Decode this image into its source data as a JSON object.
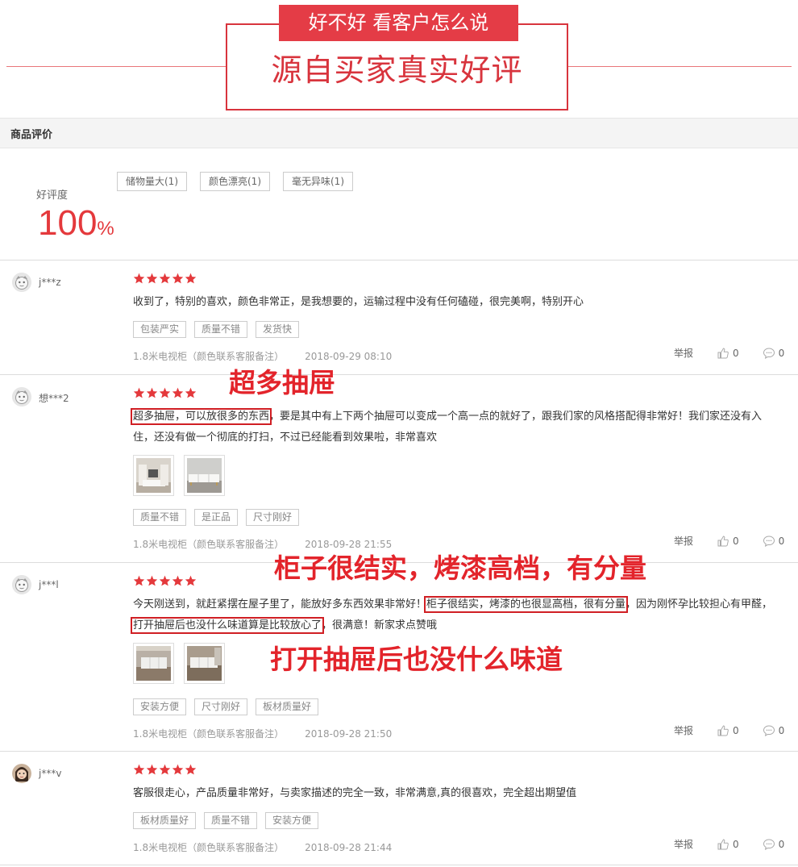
{
  "banner": {
    "tag": "好不好 看客户怎么说",
    "title": "源自买家真实好评"
  },
  "section": {
    "title": "商品评价"
  },
  "summary": {
    "rate_label": "好评度",
    "rate_value": "100",
    "rate_unit": "%",
    "tags": [
      "储物量大(1)",
      "颜色漂亮(1)",
      "毫无异味(1)"
    ]
  },
  "colors": {
    "accent": "#e4393c",
    "annotation": "#e3242b",
    "banner_red": "#d8343d"
  },
  "reviews": [
    {
      "user": "j***z",
      "rating": 5,
      "text": "收到了，特别的喜欢，颜色非常正，是我想要的，运输过程中没有任何磕碰，很完美啊，特别开心",
      "tags": [
        "包装严实",
        "质量不错",
        "发货快"
      ],
      "variant": "1.8米电视柜（颜色联系客服备注）",
      "date": "2018-09-29 08:10",
      "report": "举报",
      "likes": "0",
      "comments": "0"
    },
    {
      "user": "想***2",
      "rating": 5,
      "text_hl": "超多抽屉，可以放很多的东西",
      "text_rest": "，要是其中有上下两个抽屉可以变成一个高一点的就好了，跟我们家的风格搭配得非常好！我们家还没有入住，还没有做一个彻底的打扫，不过已经能看到效果啦，非常喜欢",
      "tags": [
        "质量不错",
        "是正品",
        "尺寸刚好"
      ],
      "variant": "1.8米电视柜（颜色联系客服备注）",
      "date": "2018-09-28 21:55",
      "report": "举报",
      "likes": "0",
      "comments": "0"
    },
    {
      "user": "j***l",
      "rating": 5,
      "text_a": "今天刚送到，就赶紧摆在屋子里了，能放好多东西效果非常好！",
      "text_hl1": "柜子很结实，烤漆的也很显高档，很有分量",
      "text_b": "，因为刚怀孕比较担心有甲醛，",
      "text_hl2": "打开抽屉后也没什么味道算是比较放心了",
      "text_c": "，很满意！新家求点赞哦",
      "tags": [
        "安装方便",
        "尺寸刚好",
        "板材质量好"
      ],
      "variant": "1.8米电视柜（颜色联系客服备注）",
      "date": "2018-09-28 21:50",
      "report": "举报",
      "likes": "0",
      "comments": "0"
    },
    {
      "user": "j***v",
      "rating": 5,
      "text": "客服很走心，产品质量非常好，与卖家描述的完全一致，非常满意,真的很喜欢，完全超出期望值",
      "tags": [
        "板材质量好",
        "质量不错",
        "安装方便"
      ],
      "variant": "1.8米电视柜（颜色联系客服备注）",
      "date": "2018-09-28 21:44",
      "report": "举报",
      "likes": "0",
      "comments": "0"
    }
  ],
  "annotations": {
    "a1": "超多抽屉",
    "a2": "柜子很结实，烤漆高档，有分量",
    "a3": "打开抽屉后也没什么味道"
  },
  "icons": [
    "default-avatar-icon",
    "user-avatar-icon",
    "star-icon",
    "thumbs-up-icon",
    "comment-icon",
    "product-photo"
  ]
}
